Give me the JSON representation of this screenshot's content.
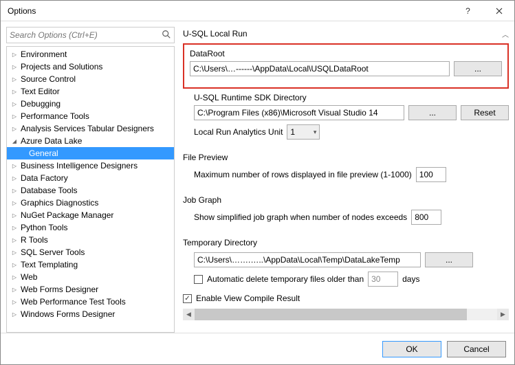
{
  "window": {
    "title": "Options"
  },
  "search": {
    "placeholder": "Search Options (Ctrl+E)"
  },
  "tree": {
    "items": [
      {
        "label": "Environment",
        "level": 0,
        "state": "collapsed"
      },
      {
        "label": "Projects and Solutions",
        "level": 0,
        "state": "collapsed"
      },
      {
        "label": "Source Control",
        "level": 0,
        "state": "collapsed"
      },
      {
        "label": "Text Editor",
        "level": 0,
        "state": "collapsed"
      },
      {
        "label": "Debugging",
        "level": 0,
        "state": "collapsed"
      },
      {
        "label": "Performance Tools",
        "level": 0,
        "state": "collapsed"
      },
      {
        "label": "Analysis Services Tabular Designers",
        "level": 0,
        "state": "collapsed"
      },
      {
        "label": "Azure Data Lake",
        "level": 0,
        "state": "expanded"
      },
      {
        "label": "General",
        "level": 1,
        "state": "noarrow",
        "selected": true
      },
      {
        "label": "Business Intelligence Designers",
        "level": 0,
        "state": "collapsed"
      },
      {
        "label": "Data Factory",
        "level": 0,
        "state": "collapsed"
      },
      {
        "label": "Database Tools",
        "level": 0,
        "state": "collapsed"
      },
      {
        "label": "Graphics Diagnostics",
        "level": 0,
        "state": "collapsed"
      },
      {
        "label": "NuGet Package Manager",
        "level": 0,
        "state": "collapsed"
      },
      {
        "label": "Python Tools",
        "level": 0,
        "state": "collapsed"
      },
      {
        "label": "R Tools",
        "level": 0,
        "state": "collapsed"
      },
      {
        "label": "SQL Server Tools",
        "level": 0,
        "state": "collapsed"
      },
      {
        "label": "Text Templating",
        "level": 0,
        "state": "collapsed"
      },
      {
        "label": "Web",
        "level": 0,
        "state": "collapsed"
      },
      {
        "label": "Web Forms Designer",
        "level": 0,
        "state": "collapsed"
      },
      {
        "label": "Web Performance Test Tools",
        "level": 0,
        "state": "collapsed"
      },
      {
        "label": "Windows Forms Designer",
        "level": 0,
        "state": "collapsed"
      }
    ]
  },
  "right": {
    "header": "U-SQL Local Run",
    "dataRoot": {
      "label": "DataRoot",
      "value": "C:\\Users\\…------\\AppData\\Local\\USQLDataRoot",
      "browse": "..."
    },
    "runtime": {
      "label": "U-SQL Runtime SDK Directory",
      "value": "C:\\Program Files (x86)\\Microsoft Visual Studio 14",
      "browse": "...",
      "reset": "Reset"
    },
    "analytics": {
      "label": "Local Run Analytics Unit",
      "value": "1"
    },
    "filePreview": {
      "header": "File Preview",
      "label": "Maximum number of rows displayed in file preview (1-1000)",
      "value": "100"
    },
    "jobGraph": {
      "header": "Job Graph",
      "label": "Show simplified job graph when number of nodes exceeds",
      "value": "800"
    },
    "tempDir": {
      "header": "Temporary Directory",
      "value": "C:\\Users\\…….…..\\AppData\\Local\\Temp\\DataLakeTemp",
      "browse": "...",
      "autoDeleteLabel1": "Automatic delete temporary files older than",
      "autoDeleteDays": "30",
      "autoDeleteLabel2": "days"
    },
    "enableCompile": {
      "label": "Enable View Compile Result",
      "checked": true
    }
  },
  "footer": {
    "ok": "OK",
    "cancel": "Cancel"
  }
}
